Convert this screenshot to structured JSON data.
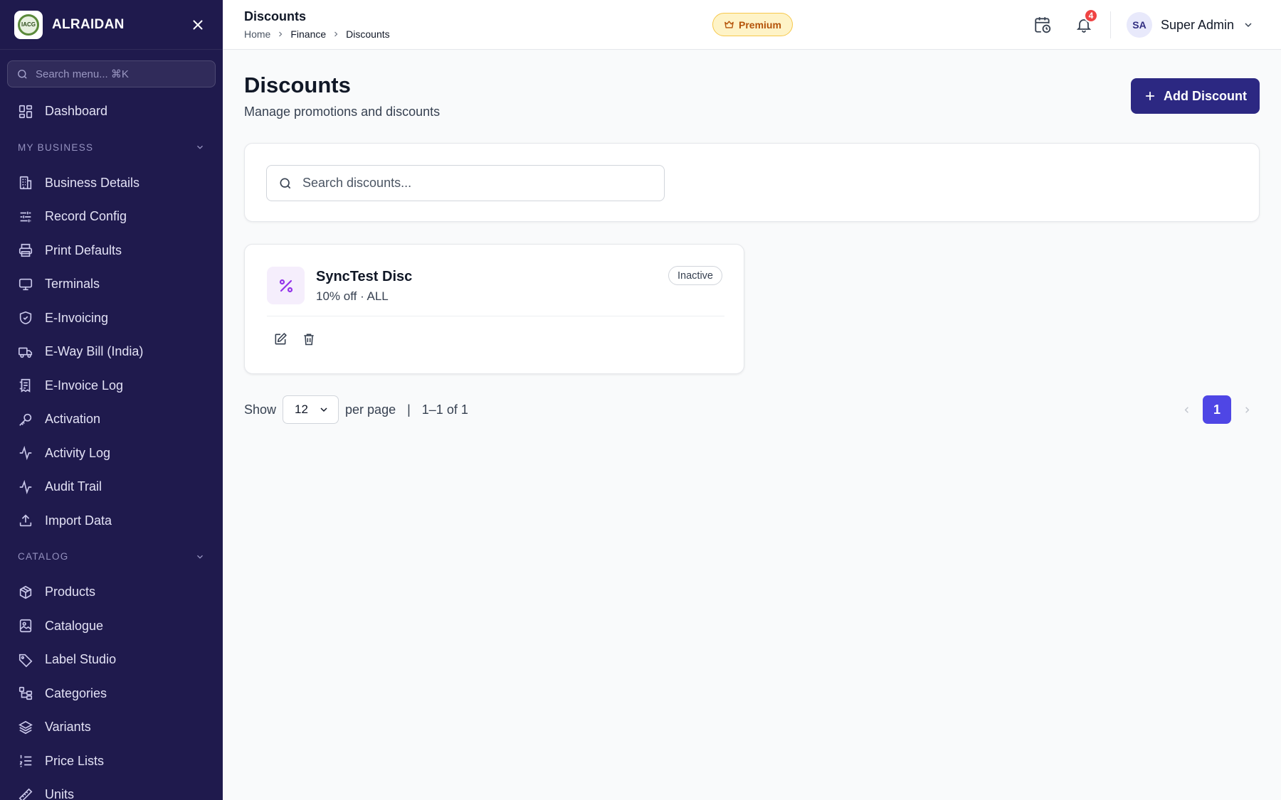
{
  "sidebar": {
    "brand": "ALRAIDAN",
    "logo_text": "IACG",
    "search_placeholder": "Search menu... ⌘K",
    "top_item": {
      "label": "Dashboard",
      "icon": "dashboard-icon"
    },
    "sections": [
      {
        "title": "MY BUSINESS",
        "items": [
          {
            "label": "Business Details",
            "icon": "building-icon"
          },
          {
            "label": "Record Config",
            "icon": "sliders-icon"
          },
          {
            "label": "Print Defaults",
            "icon": "printer-icon"
          },
          {
            "label": "Terminals",
            "icon": "monitor-icon"
          },
          {
            "label": "E-Invoicing",
            "icon": "shield-check-icon"
          },
          {
            "label": "E-Way Bill (India)",
            "icon": "truck-icon"
          },
          {
            "label": "E-Invoice Log",
            "icon": "receipt-icon"
          },
          {
            "label": "Activation",
            "icon": "key-icon"
          },
          {
            "label": "Activity Log",
            "icon": "activity-icon"
          },
          {
            "label": "Audit Trail",
            "icon": "activity-icon"
          },
          {
            "label": "Import Data",
            "icon": "upload-icon"
          }
        ]
      },
      {
        "title": "CATALOG",
        "items": [
          {
            "label": "Products",
            "icon": "package-icon"
          },
          {
            "label": "Catalogue",
            "icon": "image-icon"
          },
          {
            "label": "Label Studio",
            "icon": "tag-icon"
          },
          {
            "label": "Categories",
            "icon": "categories-icon"
          },
          {
            "label": "Variants",
            "icon": "layers-icon"
          },
          {
            "label": "Price Lists",
            "icon": "list-ordered-icon"
          },
          {
            "label": "Units",
            "icon": "ruler-icon"
          }
        ]
      }
    ]
  },
  "header": {
    "title": "Discounts",
    "breadcrumb": [
      "Home",
      "Finance",
      "Discounts"
    ],
    "premium_label": "Premium",
    "notification_count": "4",
    "user_initials": "SA",
    "user_name": "Super Admin"
  },
  "main": {
    "title": "Discounts",
    "subtitle": "Manage promotions and discounts",
    "add_button": "Add Discount",
    "search_placeholder": "Search discounts...",
    "discounts": [
      {
        "name": "SyncTest Disc",
        "detail": "10% off · ALL",
        "status": "Inactive"
      }
    ],
    "pagination": {
      "show_label": "Show",
      "per_page_value": "12",
      "per_page_label": "per page",
      "separator": "|",
      "range": "1–1 of 1",
      "current_page": "1"
    }
  },
  "colors": {
    "sidebar_bg": "#1f1a4d",
    "primary_button": "#2c2882",
    "page_active": "#4f46e5",
    "premium_bg": "#fef3c7",
    "notification_badge": "#ef4444"
  }
}
